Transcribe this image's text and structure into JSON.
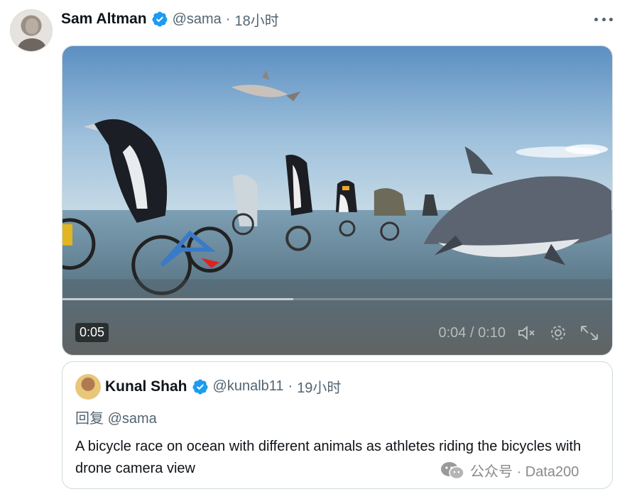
{
  "tweet": {
    "author_name": "Sam Altman",
    "handle": "@sama",
    "separator": "·",
    "time": "18小时",
    "icons": {
      "verified": "verified-badge-icon",
      "more": "more-options-icon"
    },
    "accent_color": "#1d9bf0"
  },
  "video": {
    "elapsed_badge": "0:05",
    "time_readout": "0:04 / 0:10",
    "progress": 0.42,
    "icons": [
      "mute-icon",
      "settings-icon",
      "fullscreen-icon"
    ]
  },
  "quote": {
    "author_name": "Kunal Shah",
    "handle": "@kunalb11",
    "separator": "·",
    "time": "19小时",
    "reply_prefix": "回复",
    "reply_mention": "@sama",
    "text": "A bicycle race on ocean with different animals as athletes riding the bicycles with drone camera view"
  },
  "watermark": {
    "label": "公众号 · Data200",
    "icon": "wechat-icon"
  }
}
